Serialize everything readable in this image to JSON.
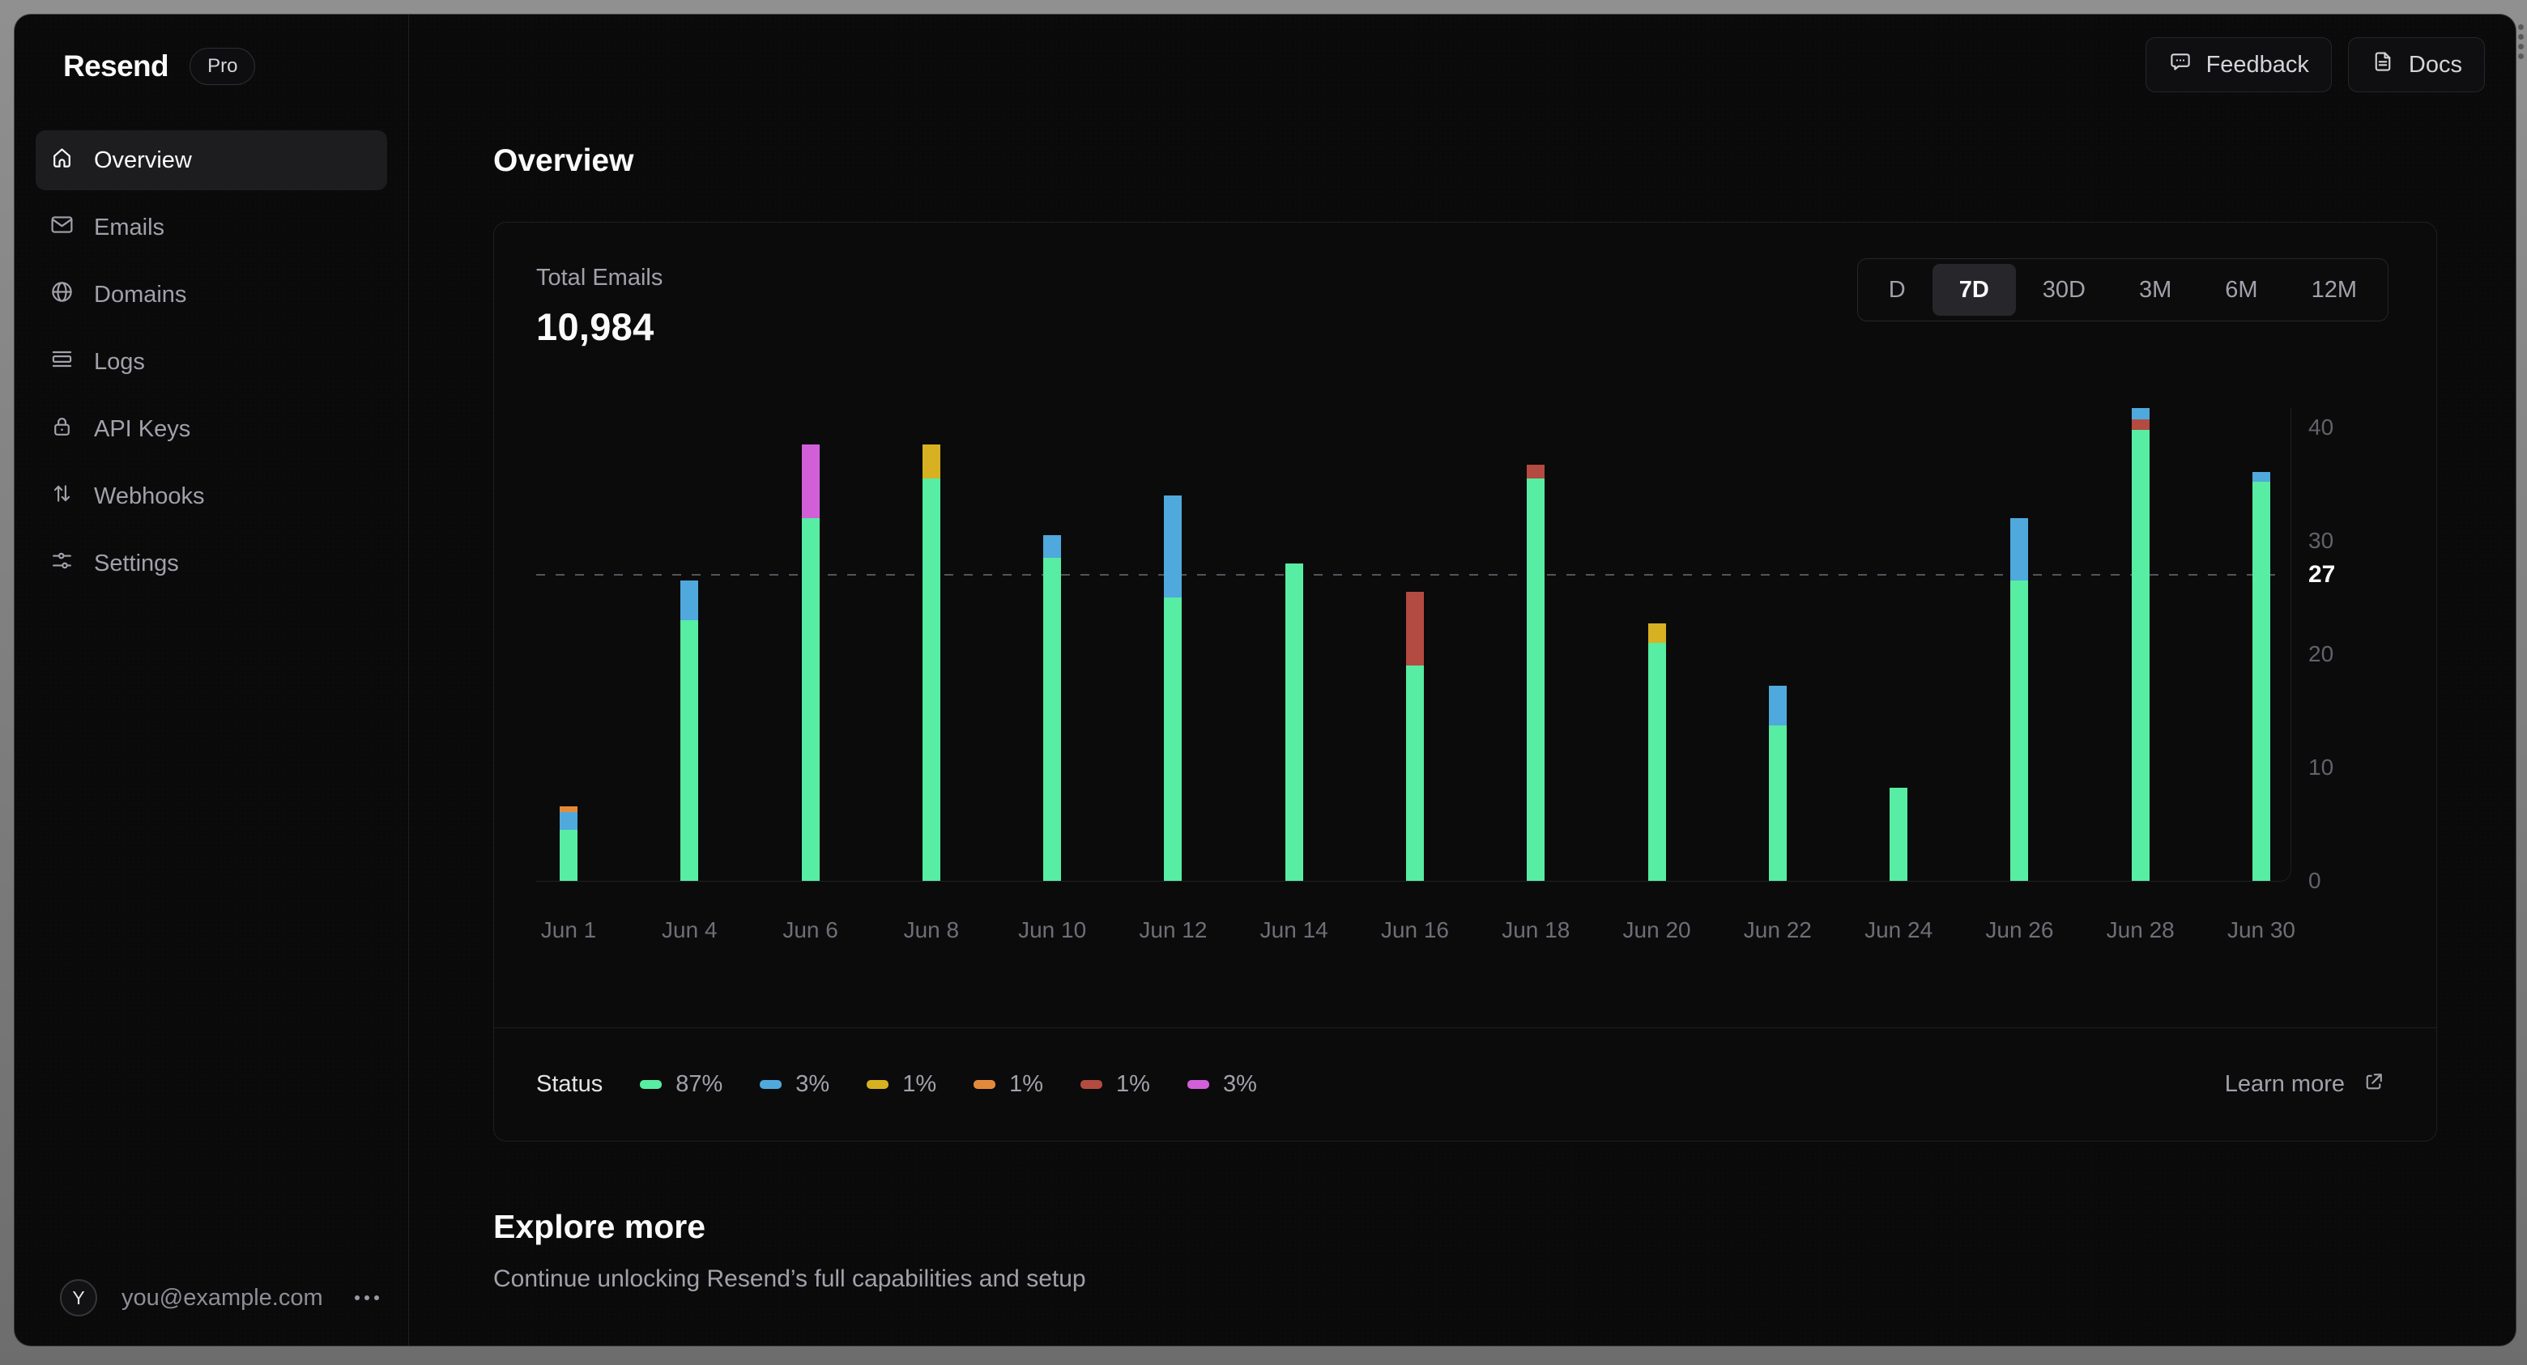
{
  "sidebar": {
    "logo": "Resend",
    "plan_badge": "Pro",
    "items": [
      {
        "label": "Overview",
        "icon": "home-icon",
        "active": true
      },
      {
        "label": "Emails",
        "icon": "mail-icon",
        "active": false
      },
      {
        "label": "Domains",
        "icon": "globe-icon",
        "active": false
      },
      {
        "label": "Logs",
        "icon": "logs-icon",
        "active": false
      },
      {
        "label": "API Keys",
        "icon": "lock-icon",
        "active": false
      },
      {
        "label": "Webhooks",
        "icon": "arrows-up-down-icon",
        "active": false
      },
      {
        "label": "Settings",
        "icon": "sliders-icon",
        "active": false
      }
    ],
    "user": {
      "avatar_initial": "Y",
      "email": "you@example.com"
    }
  },
  "header": {
    "feedback_label": "Feedback",
    "docs_label": "Docs"
  },
  "main": {
    "page_title": "Overview",
    "explore": {
      "title": "Explore more",
      "subtitle": "Continue unlocking Resend’s full capabilities and setup"
    }
  },
  "card": {
    "metric_label": "Total Emails",
    "metric_value": "10,984",
    "ranges": [
      {
        "label": "D",
        "active": false
      },
      {
        "label": "7D",
        "active": true
      },
      {
        "label": "30D",
        "active": false
      },
      {
        "label": "3M",
        "active": false
      },
      {
        "label": "6M",
        "active": false
      },
      {
        "label": "12M",
        "active": false
      }
    ],
    "legend_title": "Status",
    "legend": [
      {
        "color_key": "green",
        "pct": "87%"
      },
      {
        "color_key": "blue",
        "pct": "3%"
      },
      {
        "color_key": "yellow",
        "pct": "1%"
      },
      {
        "color_key": "orange",
        "pct": "1%"
      },
      {
        "color_key": "red",
        "pct": "1%"
      },
      {
        "color_key": "purple",
        "pct": "3%"
      }
    ],
    "learn_more_label": "Learn more"
  },
  "chart_data": {
    "type": "bar",
    "stacked": true,
    "title": "Total Emails",
    "ylim": [
      0,
      42
    ],
    "y_ticks": [
      0,
      10,
      20,
      30,
      40
    ],
    "reference_line": 27,
    "grid": "dashed-reference-only",
    "legend_position": "bottom",
    "colors": {
      "green": "#57EDA2",
      "blue": "#4FA9DC",
      "yellow": "#D8B122",
      "orange": "#E18A3C",
      "red": "#B34B41",
      "purple": "#D160D8"
    },
    "bars": [
      {
        "label": "Jun 1",
        "segments": [
          {
            "status": "green",
            "value": 4.5
          },
          {
            "status": "blue",
            "value": 1.6
          },
          {
            "status": "orange",
            "value": 0.5
          }
        ]
      },
      {
        "label": "Jun 4",
        "segments": [
          {
            "status": "green",
            "value": 23
          },
          {
            "status": "blue",
            "value": 3.5
          }
        ]
      },
      {
        "label": "Jun 6",
        "segments": [
          {
            "status": "green",
            "value": 32
          },
          {
            "status": "purple",
            "value": 6.5
          }
        ]
      },
      {
        "label": "Jun 8",
        "segments": [
          {
            "status": "green",
            "value": 35.5
          },
          {
            "status": "yellow",
            "value": 3
          }
        ]
      },
      {
        "label": "Jun 10",
        "segments": [
          {
            "status": "green",
            "value": 28.5
          },
          {
            "status": "blue",
            "value": 2
          }
        ]
      },
      {
        "label": "Jun 12",
        "segments": [
          {
            "status": "green",
            "value": 25
          },
          {
            "status": "blue",
            "value": 9
          }
        ]
      },
      {
        "label": "Jun 14",
        "segments": [
          {
            "status": "green",
            "value": 28
          }
        ]
      },
      {
        "label": "Jun 16",
        "segments": [
          {
            "status": "green",
            "value": 19
          },
          {
            "status": "red",
            "value": 6.5
          }
        ]
      },
      {
        "label": "Jun 18",
        "segments": [
          {
            "status": "green",
            "value": 35.5
          },
          {
            "status": "red",
            "value": 1.2
          }
        ]
      },
      {
        "label": "Jun 20",
        "segments": [
          {
            "status": "green",
            "value": 21
          },
          {
            "status": "yellow",
            "value": 1.7
          }
        ]
      },
      {
        "label": "Jun 22",
        "segments": [
          {
            "status": "green",
            "value": 13.7
          },
          {
            "status": "blue",
            "value": 3.5
          }
        ]
      },
      {
        "label": "Jun 24",
        "segments": [
          {
            "status": "green",
            "value": 8.2
          }
        ]
      },
      {
        "label": "Jun 26",
        "segments": [
          {
            "status": "green",
            "value": 26.5
          },
          {
            "status": "blue",
            "value": 5.5
          }
        ]
      },
      {
        "label": "Jun 28",
        "segments": [
          {
            "status": "green",
            "value": 39.8
          },
          {
            "status": "red",
            "value": 0.9
          },
          {
            "status": "blue",
            "value": 1.0
          }
        ]
      },
      {
        "label": "Jun 30",
        "segments": [
          {
            "status": "green",
            "value": 35.2
          },
          {
            "status": "blue",
            "value": 0.9
          }
        ]
      }
    ]
  }
}
